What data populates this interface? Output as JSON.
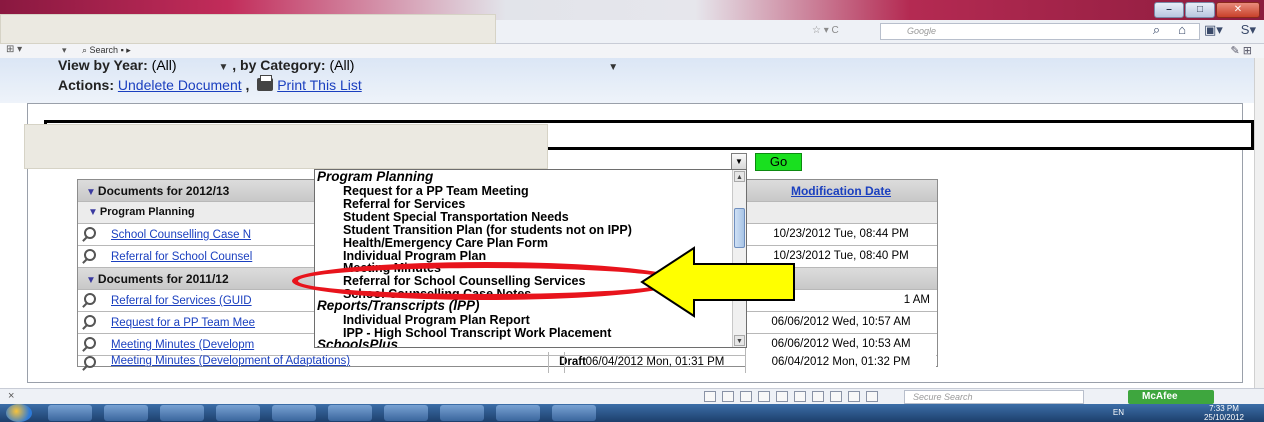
{
  "browser": {
    "search_placeholder": "Google",
    "toolbar_search_label": "Search",
    "secure_search_placeholder": "Secure Search",
    "mcafee_label": "McAfee"
  },
  "filters": {
    "year_label": "View by Year:",
    "year_value": "(All)",
    "category_label": ", by Category:",
    "category_value": "(All)"
  },
  "actions": {
    "label": "Actions:",
    "undelete": "Undelete Document",
    "separator": ",",
    "print": "Print This List"
  },
  "go_button": "Go",
  "table": {
    "modification_header": "Modification Date",
    "groups": [
      {
        "title": "Documents for 2012/13",
        "subgroup": "Program Planning",
        "rows": [
          {
            "name": "School Counselling Case N",
            "modified": "10/23/2012 Tue, 08:44 PM"
          },
          {
            "name": "Referral for School Counsel",
            "modified": "10/23/2012 Tue, 08:40 PM"
          }
        ]
      },
      {
        "title": "Documents for 2011/12",
        "rows": [
          {
            "name": "Referral for Services (GUID",
            "modified": "1 AM"
          },
          {
            "name": "Request for a PP Team Mee",
            "modified": "06/06/2012 Wed, 10:57 AM"
          },
          {
            "name": "Meeting Minutes (Developm",
            "modified": "06/06/2012 Wed, 10:53 AM"
          },
          {
            "name": "Meeting Minutes (Development of Adaptations)",
            "status": "Draft",
            "date": "06/04/2012 Mon, 01:31 PM",
            "modified": "06/04/2012 Mon, 01:32 PM"
          }
        ]
      }
    ]
  },
  "dropdown": {
    "group1": "Program Planning",
    "items1": [
      "Request for a PP Team Meeting",
      "Referral for Services",
      "Student Special Transportation Needs",
      "Student Transition Plan (for students not on IPP)",
      "Health/Emergency Care Plan Form",
      "Individual Program Plan",
      "Meeting Minutes",
      "Referral for School Counselling Services",
      "School Counselling Case Notes"
    ],
    "group2": "Reports/Transcripts (IPP)",
    "items2": [
      "Individual Program Plan Report",
      "IPP - High School Transcript Work Placement"
    ],
    "group3": "SchoolsPlus"
  },
  "taskbar": {
    "lang": "EN",
    "time": "7:33 PM",
    "date": "25/10/2012"
  },
  "colors": {
    "highlight_ellipse": "#e8141c",
    "arrow_fill": "#ffff00",
    "go_button": "#19e01f",
    "link": "#1a3fbf"
  }
}
